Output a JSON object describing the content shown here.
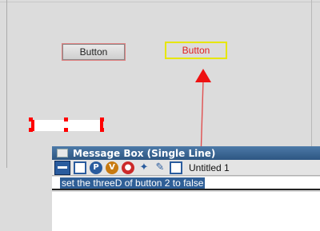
{
  "canvas": {
    "button_1_label": "Button",
    "button_2_label": "Button"
  },
  "message_box": {
    "title": "Message Box (Single Line)",
    "stack_name": "Untitled 1",
    "command": "set the threeD of button 2 to false",
    "toolbar_icons": [
      "single-line-icon",
      "window-icon",
      "p-icon",
      "v-icon",
      "record-icon",
      "gear-icon",
      "script-icon",
      "windows-icon"
    ]
  }
}
